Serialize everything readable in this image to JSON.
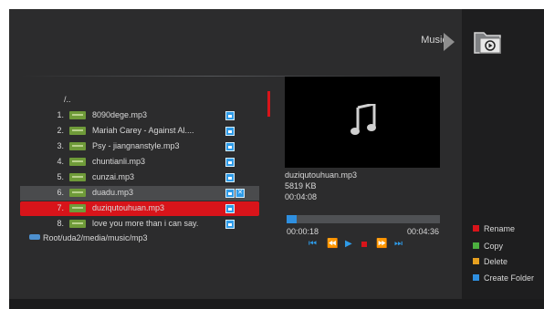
{
  "page_title": "Music",
  "colors": {
    "red": "#d8141a",
    "green": "#4caf3f",
    "yellow": "#e6a020",
    "blue": "#2e8fe0"
  },
  "file_list": {
    "parent_dir": "/..",
    "items": [
      {
        "num": "1.",
        "name": "8090dege.mp3",
        "badge": "MP3",
        "icon": "heart-icon"
      },
      {
        "num": "2.",
        "name": "Mariah Carey - Against Al....",
        "badge": "MP3",
        "icon": "heart-icon"
      },
      {
        "num": "3.",
        "name": "Psy - jiangnanstyle.mp3",
        "badge": "MP3",
        "icon": "heart-icon"
      },
      {
        "num": "4.",
        "name": "chuntianli.mp3",
        "badge": "MP3",
        "icon": "heart-icon"
      },
      {
        "num": "5.",
        "name": "cunzai.mp3",
        "badge": "MP3",
        "icon": "heart-icon"
      },
      {
        "num": "6.",
        "name": "duadu.mp3",
        "badge": "MP3",
        "icon": "heart-icon"
      },
      {
        "num": "7.",
        "name": "duziqutouhuan.mp3",
        "badge": "MP3",
        "icon": "heart-icon"
      },
      {
        "num": "8.",
        "name": "love you more than i can say.",
        "badge": "MP3",
        "icon": "heart-icon"
      }
    ]
  },
  "path": "Root/uda2/media/music/mp3",
  "now_playing": {
    "filename": "duziqutouhuan.mp3",
    "size": "5819 KB",
    "duration": "00:04:08",
    "elapsed": "00:00:18",
    "total": "00:04:36",
    "progress": 0.065
  },
  "controls": [
    "rewind-fast-icon",
    "rewind-icon",
    "play-icon",
    "stop-icon",
    "forward-icon",
    "forward-fast-icon"
  ],
  "legend": [
    {
      "label": "Rename",
      "color": "#d8141a"
    },
    {
      "label": "Copy",
      "color": "#4caf3f"
    },
    {
      "label": "Delete",
      "color": "#e6a020"
    },
    {
      "label": "Create Folder",
      "color": "#2e8fe0"
    }
  ]
}
